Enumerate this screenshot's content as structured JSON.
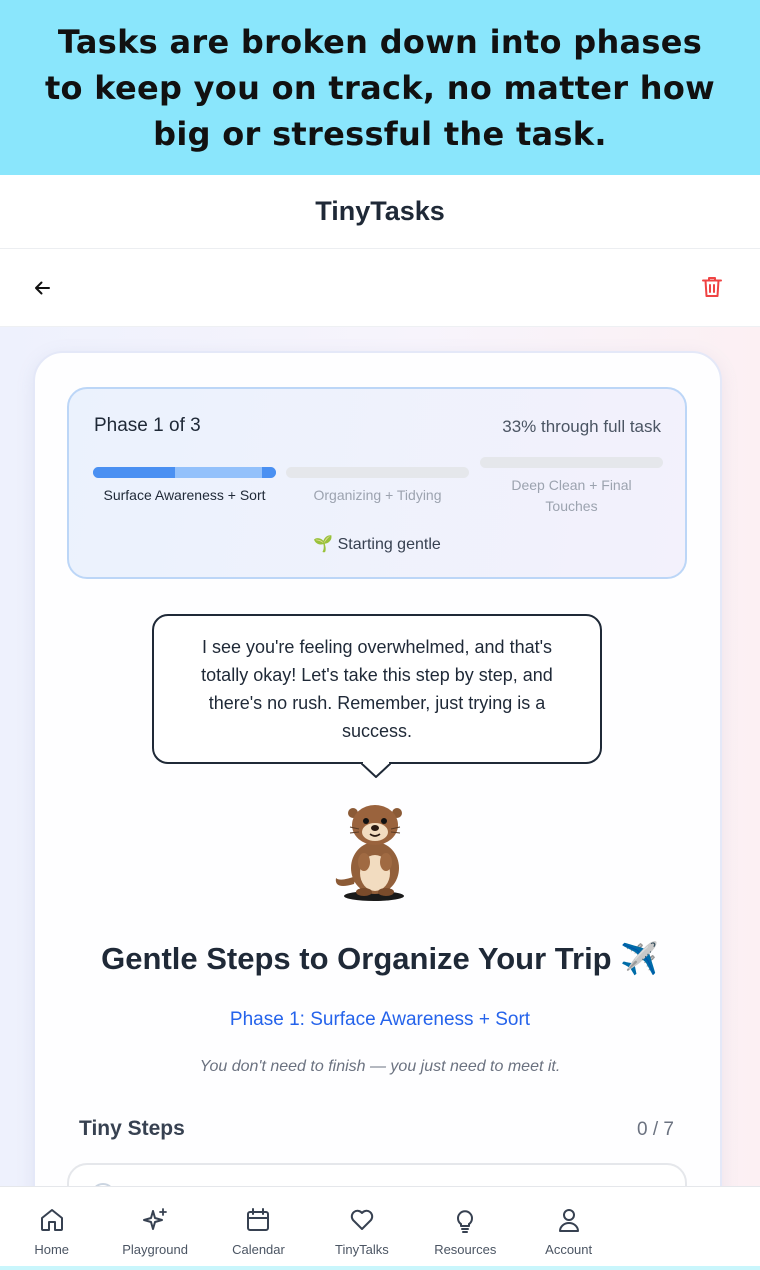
{
  "banner": {
    "text": "Tasks are broken down into phases to keep you on track, no matter how big or stressful the task."
  },
  "app": {
    "title": "TinyTasks"
  },
  "toolbar": {
    "back_icon": "arrow-left-icon",
    "delete_icon": "trash-icon",
    "delete_color": "#ef4444"
  },
  "progress": {
    "phase_label": "Phase 1 of 3",
    "percent_label": "33% through full task",
    "current_phase_fraction": 0.45,
    "phases": [
      {
        "label": "Surface Awareness + Sort",
        "state": "active"
      },
      {
        "label": "Organizing + Tidying",
        "state": "upcoming"
      },
      {
        "label": "Deep Clean + Final Touches",
        "state": "upcoming"
      }
    ],
    "status_icon": "🌱",
    "status_text": "Starting gentle"
  },
  "message": {
    "text": "I see you're feeling overwhelmed, and that's totally okay! Let's take this step by step, and there's no rush. Remember, just trying is a success."
  },
  "task": {
    "title": "Gentle Steps to Organize Your Trip ✈️",
    "phase_title": "Phase 1: Surface Awareness + Sort",
    "quote": "You don't need to finish — you just need to meet it."
  },
  "steps": {
    "header": "Tiny Steps",
    "count": "0 / 7"
  },
  "nav": {
    "items": [
      {
        "label": "Home",
        "icon": "home-icon"
      },
      {
        "label": "Playground",
        "icon": "sparkles-icon"
      },
      {
        "label": "Calendar",
        "icon": "calendar-icon"
      },
      {
        "label": "TinyTalks",
        "icon": "heart-icon"
      },
      {
        "label": "Resources",
        "icon": "lightbulb-icon"
      },
      {
        "label": "Account",
        "icon": "user-icon"
      }
    ]
  },
  "colors": {
    "banner": "#8ae6fc",
    "accent": "#4a90f2",
    "link": "#2563eb"
  }
}
